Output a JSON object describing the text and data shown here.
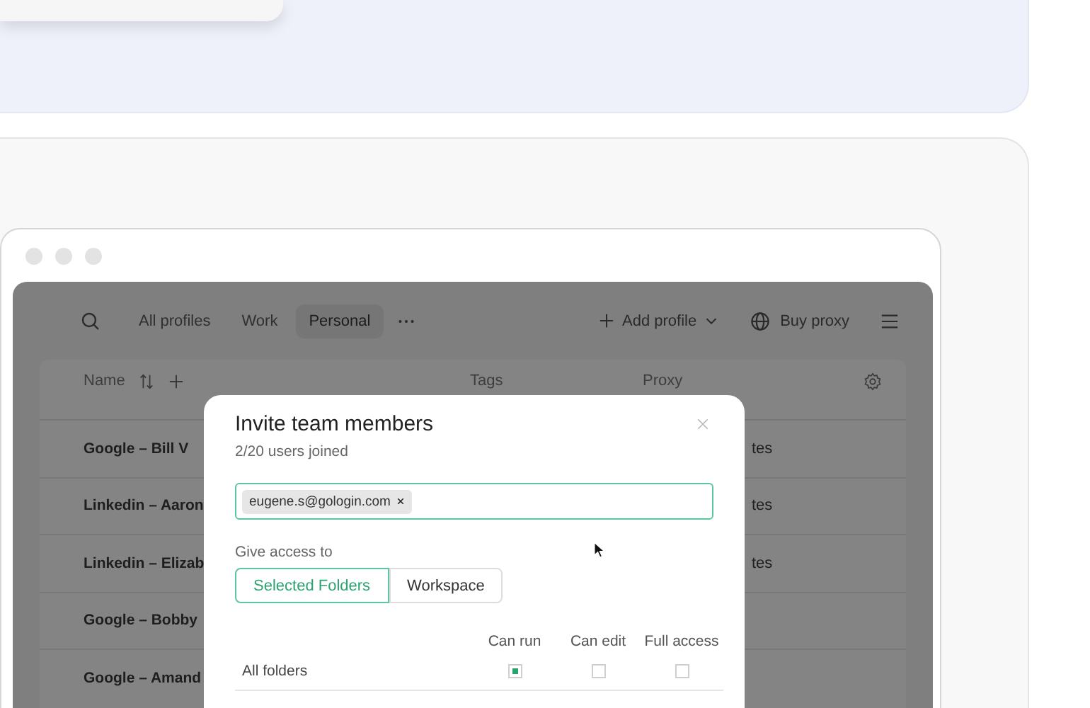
{
  "app": {
    "tabs": [
      {
        "label": "All profiles",
        "selected": false
      },
      {
        "label": "Work",
        "selected": false
      },
      {
        "label": "Personal",
        "selected": true
      }
    ],
    "add_profile": "Add profile",
    "buy_proxy": "Buy proxy"
  },
  "table": {
    "columns": [
      "Name",
      "Tags",
      "Proxy"
    ],
    "rows": [
      {
        "name": "Google – Bill V",
        "proxy": "tes"
      },
      {
        "name": "Linkedin – Aaron",
        "proxy": "tes"
      },
      {
        "name": "Linkedin – Elizab",
        "proxy": "tes"
      },
      {
        "name": "Google – Bobby"
      },
      {
        "name": "Google – Amand"
      }
    ]
  },
  "modal": {
    "title": "Invite team members",
    "subtitle": "2/20 users joined",
    "emails": [
      "eugene.s@gologin.com"
    ],
    "access_label": "Give access to",
    "access_options": [
      {
        "label": "Selected Folders",
        "selected": true
      },
      {
        "label": "Workspace",
        "selected": false
      }
    ],
    "permission_columns": [
      "Can run",
      "Can edit",
      "Full access"
    ],
    "folders": [
      {
        "name": "All folders",
        "permissions": [
          {
            "checked": true
          },
          {
            "checked": false
          },
          {
            "checked": false
          }
        ]
      }
    ]
  }
}
